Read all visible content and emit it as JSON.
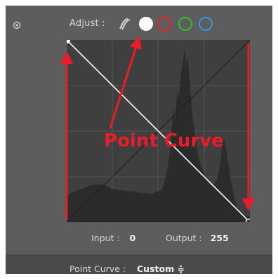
{
  "toolbar": {
    "adjust_label": "Adjust :",
    "channels": [
      {
        "name": "parametric",
        "color": "#cfcfcf"
      },
      {
        "name": "rgb",
        "color": "#ffffff"
      },
      {
        "name": "red",
        "color": "#e8202f"
      },
      {
        "name": "green",
        "color": "#2ec02e"
      },
      {
        "name": "blue",
        "color": "#2f95e6"
      }
    ]
  },
  "readout": {
    "input_label": "Input :",
    "input_value": "0",
    "output_label": "Output :",
    "output_value": "255"
  },
  "footer": {
    "curve_label": "Point Curve :",
    "curve_value": "Custom ≑"
  },
  "annotation": {
    "text": "Point Curve",
    "color": "#ea1c2a"
  },
  "colors": {
    "panel": "#5d5d5d",
    "graph_bg": "#3f3f3f",
    "histogram": "#2b2b2b",
    "accent": "#ea1c2a"
  }
}
